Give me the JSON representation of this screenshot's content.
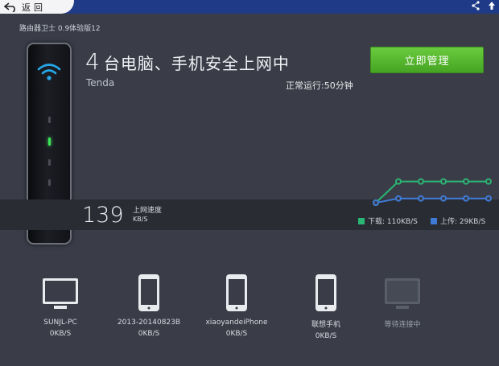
{
  "header": {
    "back_label": "返回",
    "version": "路由器卫士 0.9体验版12"
  },
  "status": {
    "count": "4",
    "headline_text": "台电脑、手机安全上网中",
    "brand": "Tenda",
    "uptime": "正常运行:50分钟",
    "manage_button": "立即管理"
  },
  "speed": {
    "value": "139",
    "caption": "上网速度",
    "unit": "KB/S"
  },
  "chart_data": {
    "type": "line",
    "x": [
      0,
      1,
      2,
      3,
      4,
      5
    ],
    "series": [
      {
        "name": "下载: 110KB/S",
        "color": "#2bb673",
        "values": [
          0,
          20,
          20,
          20,
          20,
          20
        ]
      },
      {
        "name": "上传: 29KB/S",
        "color": "#3f7bd6",
        "values": [
          0,
          4,
          4,
          4,
          4,
          4
        ]
      }
    ]
  },
  "legend": {
    "download": "下载: 110KB/S",
    "upload": "上传: 29KB/S",
    "download_color": "#2bb673",
    "upload_color": "#3f7bd6"
  },
  "devices": [
    {
      "name": "SUNJL-PC",
      "speed": "0KB/S",
      "icon": "monitor-icon"
    },
    {
      "name": "2013-20140823B",
      "speed": "0KB/S",
      "icon": "phone-icon"
    },
    {
      "name": "xiaoyandeiPhone",
      "speed": "0KB/S",
      "icon": "phone-icon"
    },
    {
      "name": "联想手机",
      "speed": "0KB/S",
      "icon": "phone-icon"
    },
    {
      "name": "等待连接中",
      "speed": "",
      "icon": "monitor-icon"
    }
  ],
  "colors": {
    "accent_green": "#4fb32a",
    "header_blue": "#1f3a86",
    "background": "#3a3d48"
  }
}
